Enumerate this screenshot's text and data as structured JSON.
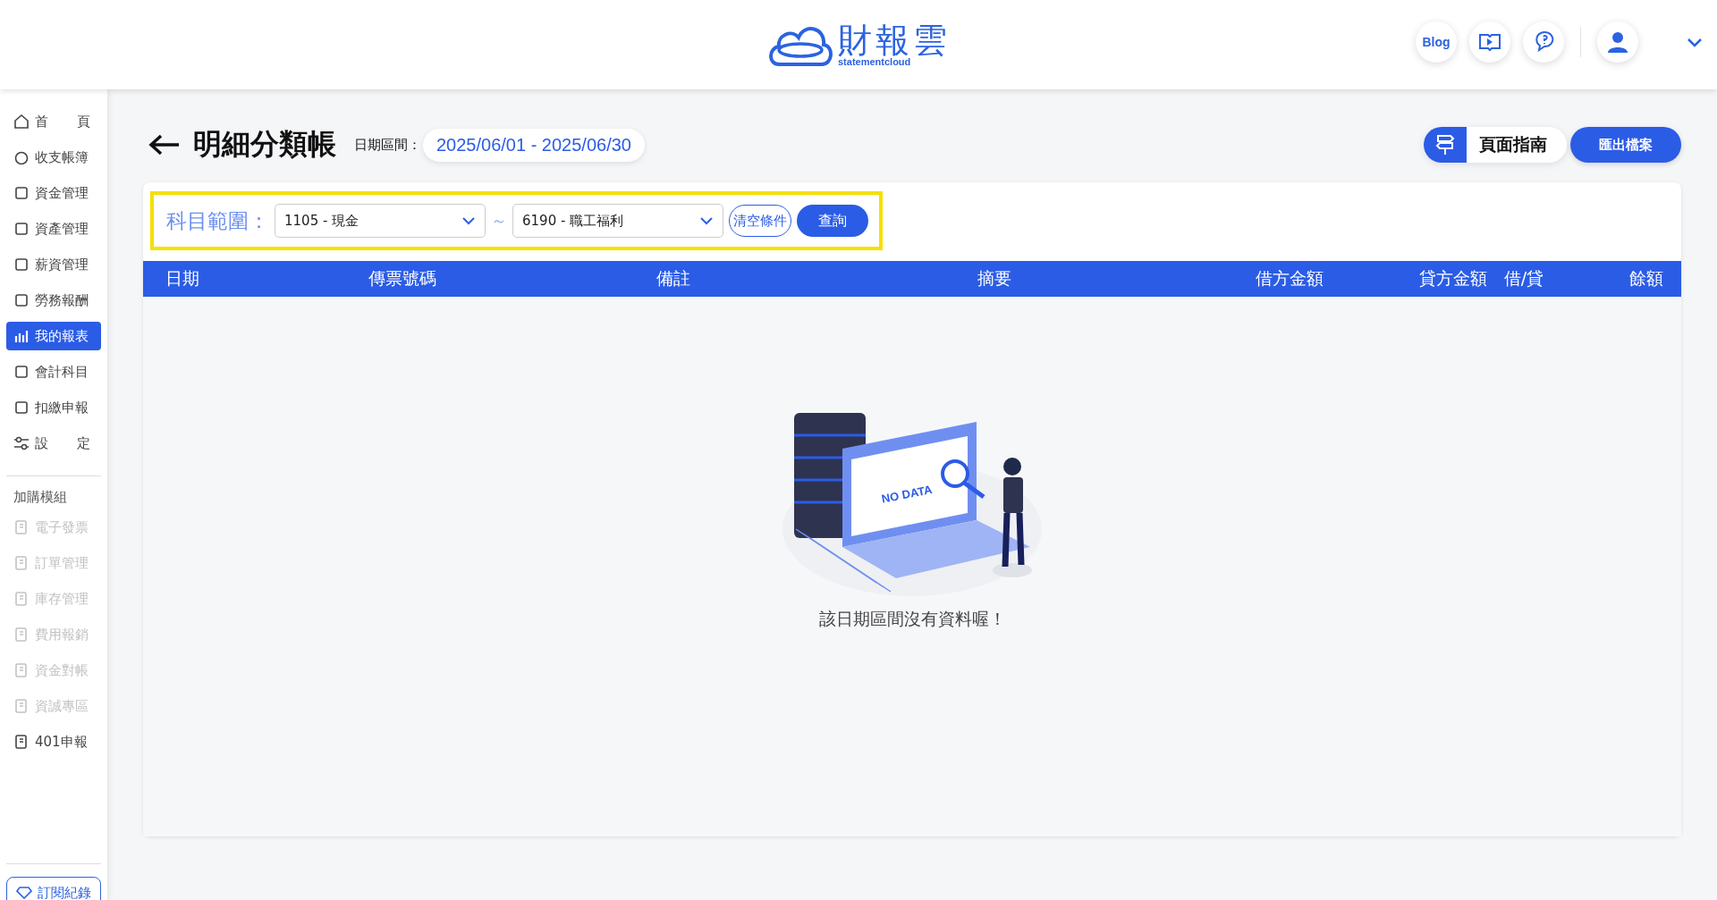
{
  "header": {
    "logo_text": "財報雲",
    "logo_subtext": "statementcloud",
    "blog_label": "Blog"
  },
  "sidebar": {
    "items": [
      {
        "label": "首頁",
        "selected": false
      },
      {
        "label": "收支帳簿",
        "selected": false
      },
      {
        "label": "資金管理",
        "selected": false
      },
      {
        "label": "資產管理",
        "selected": false
      },
      {
        "label": "薪資管理",
        "selected": false
      },
      {
        "label": "勞務報酬",
        "selected": false
      },
      {
        "label": "我的報表",
        "selected": true
      },
      {
        "label": "會計科目",
        "selected": false
      },
      {
        "label": "扣繳申報",
        "selected": false
      },
      {
        "label": "設定",
        "selected": false
      }
    ],
    "addon_heading": "加購模組",
    "addons": [
      {
        "label": "電子發票",
        "disabled": true
      },
      {
        "label": "訂單管理",
        "disabled": true
      },
      {
        "label": "庫存管理",
        "disabled": true
      },
      {
        "label": "費用報銷",
        "disabled": true
      },
      {
        "label": "資金對帳",
        "disabled": true
      },
      {
        "label": "資誠專區",
        "disabled": true
      },
      {
        "label": "401申報",
        "disabled": false
      }
    ],
    "subscription_button": "訂閱紀錄"
  },
  "page": {
    "title": "明細分類帳",
    "date_label": "日期區間：",
    "date_range": "2025/06/01 - 2025/06/30",
    "guide_button": "頁面指南",
    "export_button": "匯出檔案"
  },
  "filter": {
    "label": "科目範圍：",
    "from_value": "1105 - 現金",
    "separator": "～",
    "to_value": "6190 - 職工福利",
    "clear_button": "清空條件",
    "search_button": "查詢"
  },
  "table": {
    "columns": [
      "日期",
      "傳票號碼",
      "備註",
      "摘要",
      "借方金額",
      "貸方金額",
      "借/貸",
      "餘額"
    ],
    "empty_illustration_text": "NO DATA",
    "empty_message": "該日期區間沒有資料喔！"
  }
}
